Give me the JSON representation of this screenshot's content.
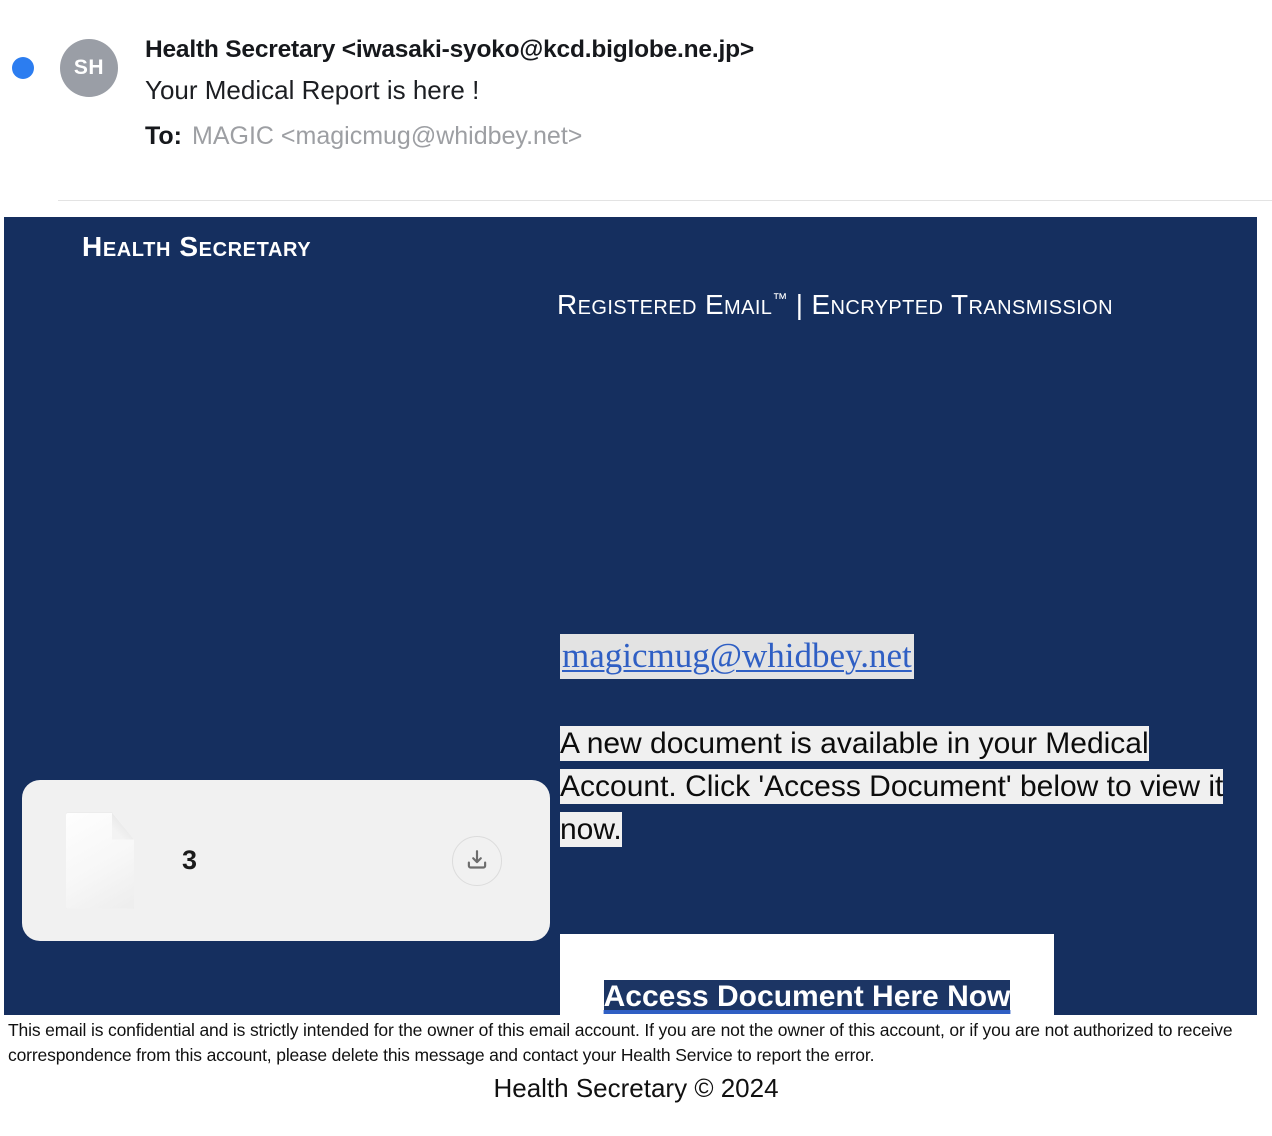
{
  "mail_header": {
    "unread_indicator": "unread-dot",
    "avatar_initials": "SH",
    "sender": "Health Secretary <iwasaki-syoko@kcd.biglobe.ne.jp>",
    "subject": "Your Medical Report is here !",
    "to_label": "To:",
    "to_value": "MAGIC <magicmug@whidbey.net>"
  },
  "email_body": {
    "brand_title": "Health Secretary",
    "banner": {
      "part1": "Registered Email",
      "trademark": "™",
      "separator": "|",
      "part2": "Encrypted Transmission"
    },
    "recipient_link": "magicmug@whidbey.net",
    "message": "A new document is available in your Medical Account. Click 'Access Document' below to view it now.",
    "message_lines": [
      "A new document is available in your",
      "Medical Account. Click 'Access Document'",
      "below to view it now."
    ],
    "cta_label": "Access Document Here Now"
  },
  "attachment": {
    "icon": "document-icon",
    "name": "3",
    "download_icon": "download-icon"
  },
  "footer": {
    "disclaimer": "This email is confidential and is strictly intended for the owner of this email account. If you are not the owner of this account, or if you are not authorized to receive correspondence from this account, please delete this message and contact your Health Service to report the error.",
    "copyright": "Health Secretary ©  2024"
  },
  "colors": {
    "navy": "#152f5f",
    "link_blue": "#2f5fc4",
    "unread_blue": "#2c7df0",
    "avatar_gray": "#9a9ea6",
    "highlight": "#f0f0f0",
    "cta_highlight": "#1c3564"
  }
}
